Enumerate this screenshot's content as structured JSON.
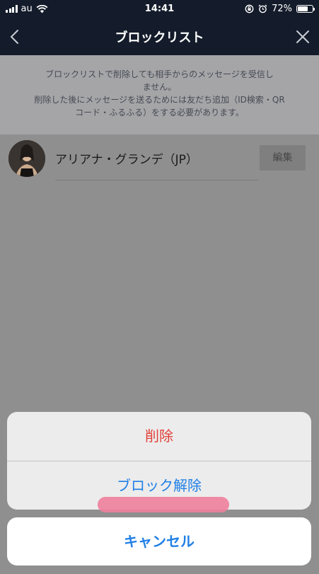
{
  "status_bar": {
    "carrier": "au",
    "time": "14:41",
    "battery_percent_text": "72%",
    "battery_level": 0.72
  },
  "nav": {
    "title": "ブロックリスト",
    "back_icon": "chevron-left-icon",
    "close_icon": "close-icon"
  },
  "notice": {
    "line1": "ブロックリストで削除しても相手からのメッセージを受信し",
    "line2": "ません。",
    "line3": "削除した後にメッセージを送るためには友だち追加（ID検索・QR",
    "line4": "コード・ふるふる）をする必要があります。"
  },
  "blocked_list": [
    {
      "name": "アリアナ・グランデ（JP）",
      "edit_label": "編集"
    }
  ],
  "action_sheet": {
    "delete_label": "削除",
    "unblock_label": "ブロック解除",
    "cancel_label": "キャンセル"
  },
  "colors": {
    "nav_bg": "#141c2b",
    "destructive": "#e0413a",
    "action": "#1f7fe6",
    "highlight": "#f07f9c"
  }
}
